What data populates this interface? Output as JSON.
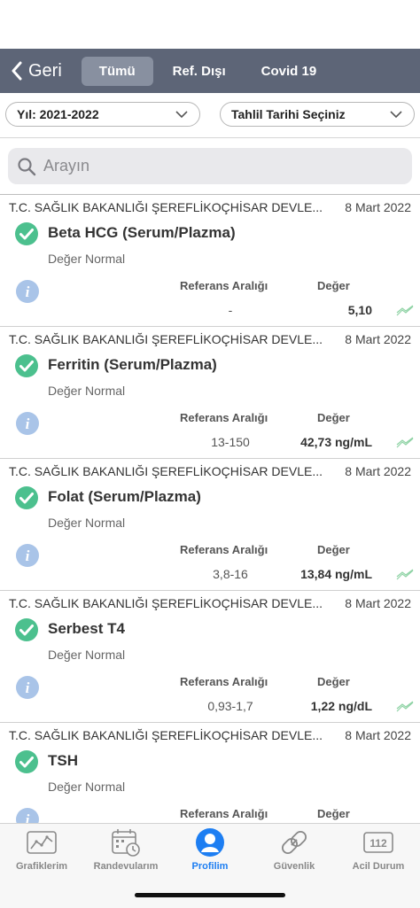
{
  "header": {
    "back_label": "Geri",
    "tabs": [
      {
        "label": "Tümü",
        "active": true
      },
      {
        "label": "Ref. Dışı",
        "active": false
      },
      {
        "label": "Covid 19",
        "active": false
      }
    ],
    "bar_color": "#5d6577"
  },
  "filters": {
    "year_select": "Yıl: 2021-2022",
    "date_select": "Tahlil Tarihi Seçiniz"
  },
  "search": {
    "placeholder": "Arayın"
  },
  "results": {
    "ref_header": "Referans Aralığı",
    "value_header": "Değer",
    "items": [
      {
        "institution": "T.C. SAĞLIK BAKANLIĞI ŞEREFLİKOÇHİSAR DEVLE...",
        "date": "8 Mart 2022",
        "test": "Beta HCG (Serum/Plazma)",
        "status": "Değer Normal",
        "ref": "-",
        "value": "5,10"
      },
      {
        "institution": "T.C. SAĞLIK BAKANLIĞI ŞEREFLİKOÇHİSAR DEVLE...",
        "date": "8 Mart 2022",
        "test": "Ferritin (Serum/Plazma)",
        "status": "Değer Normal",
        "ref": "13-150",
        "value": "42,73 ng/mL"
      },
      {
        "institution": "T.C. SAĞLIK BAKANLIĞI ŞEREFLİKOÇHİSAR DEVLE...",
        "date": "8 Mart 2022",
        "test": "Folat (Serum/Plazma)",
        "status": "Değer Normal",
        "ref": "3,8-16",
        "value": "13,84 ng/mL"
      },
      {
        "institution": "T.C. SAĞLIK BAKANLIĞI ŞEREFLİKOÇHİSAR DEVLE...",
        "date": "8 Mart 2022",
        "test": "Serbest T4",
        "status": "Değer Normal",
        "ref": "0,93-1,7",
        "value": "1,22 ng/dL"
      },
      {
        "institution": "T.C. SAĞLIK BAKANLIĞI ŞEREFLİKOÇHİSAR DEVLE...",
        "date": "8 Mart 2022",
        "test": "TSH",
        "status": "Değer Normal",
        "ref": "",
        "value": ""
      }
    ],
    "check_color": "#4cc08e",
    "info_color": "#a9c4e8"
  },
  "bottom_nav": {
    "items": [
      {
        "label": "Grafiklerim",
        "icon": "chart-icon"
      },
      {
        "label": "Randevularım",
        "icon": "calendar-clock-icon"
      },
      {
        "label": "Profilim",
        "icon": "profile-icon",
        "active": true
      },
      {
        "label": "Güvenlik",
        "icon": "link-icon"
      },
      {
        "label": "Acil Durum",
        "icon": "emergency-112-icon",
        "badge": "112"
      }
    ],
    "active_color": "#1d7ef2"
  }
}
